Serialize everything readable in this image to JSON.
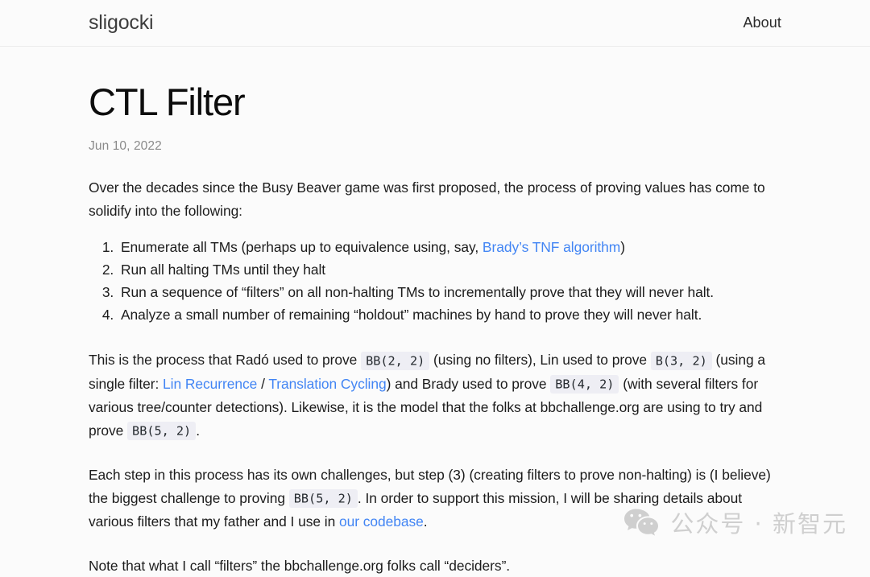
{
  "header": {
    "brand": "sligocki",
    "nav": [
      {
        "label": "About",
        "name": "nav-link-about"
      }
    ]
  },
  "article": {
    "title": "CTL Filter",
    "date": "Jun 10, 2022",
    "intro": {
      "text": "Over the decades since the Busy Beaver game was first proposed, the process of proving values has come to solidify into the following:"
    },
    "steps": [
      {
        "pre": "Enumerate all TMs (perhaps up to equivalence using, say, ",
        "link": "Brady’s TNF algorithm",
        "post": ")"
      },
      {
        "pre": "Run all halting TMs until they halt",
        "link": "",
        "post": ""
      },
      {
        "pre": "Run a sequence of “filters” on all non-halting TMs to incrementally prove that they will never halt.",
        "link": "",
        "post": ""
      },
      {
        "pre": "Analyze a small number of remaining “holdout” machines by hand to prove they will never halt.",
        "link": "",
        "post": ""
      }
    ],
    "para2": {
      "s1": "This is the process that Radó used to prove ",
      "code1": "BB(2, 2)",
      "s2": " (using no filters), Lin used to prove ",
      "code2": "B(3, 2)",
      "s3": " (using a single filter: ",
      "link1": "Lin Recurrence",
      "s4": " / ",
      "link2": "Translation Cycling",
      "s5": ") and Brady used to prove ",
      "code3": "BB(4, 2)",
      "s6": " (with several filters for various tree/counter detections). Likewise, it is the model that the folks at bbchallenge.org are using to try and prove ",
      "code4": "BB(5, 2)",
      "s7": "."
    },
    "para3": {
      "s1": "Each step in this process has its own challenges, but step (3) (creating filters to prove non-halting) is (I believe) the biggest challenge to proving ",
      "code1": "BB(5, 2)",
      "s2": ". In order to support this mission, I will be sharing details about various filters that my father and I use in ",
      "link1": "our codebase",
      "s3": "."
    },
    "para4": {
      "text": "Note that what I call “filters” the bbchallenge.org folks call “deciders”."
    }
  },
  "watermark": {
    "text": "公众号 · 新智元",
    "icon": "wechat-icon"
  },
  "colors": {
    "background": "#fbfbfb",
    "link": "#4285f4",
    "code_background": "#eeeef4",
    "text": "#1c1c1c",
    "date": "#8a8a8a",
    "header_border": "#ebebeb",
    "watermark": "#cfcfcf"
  }
}
